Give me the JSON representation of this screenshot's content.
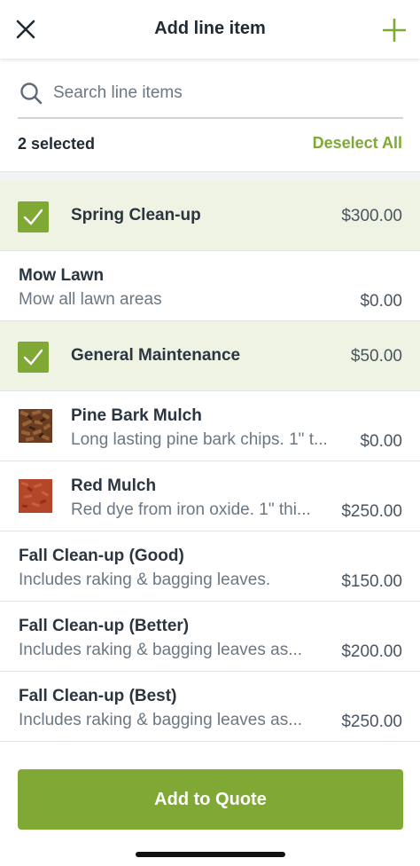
{
  "header": {
    "title": "Add line item",
    "close_icon": "close-icon",
    "add_icon": "plus-icon"
  },
  "search": {
    "placeholder": "Search line items",
    "value": ""
  },
  "selection": {
    "count_label": "2 selected",
    "deselect_label": "Deselect All"
  },
  "colors": {
    "accent": "#7fa934",
    "selected_row": "#eef3e4",
    "text": "#2a3540",
    "muted": "#6b7782"
  },
  "items": [
    {
      "name": "Spring Clean-up",
      "description": "",
      "price": "$300.00",
      "selected": true,
      "thumbnail": ""
    },
    {
      "name": "Mow Lawn",
      "description": "Mow all lawn areas",
      "price": "$0.00",
      "selected": false,
      "thumbnail": ""
    },
    {
      "name": "General Maintenance",
      "description": "",
      "price": "$50.00",
      "selected": true,
      "thumbnail": ""
    },
    {
      "name": "Pine Bark Mulch",
      "description": "Long lasting pine bark chips. 1\" t...",
      "price": "$0.00",
      "selected": false,
      "thumbnail": "pine-bark-mulch-image"
    },
    {
      "name": "Red Mulch",
      "description": "Red dye from iron oxide. 1\" thi...",
      "price": "$250.00",
      "selected": false,
      "thumbnail": "red-mulch-image"
    },
    {
      "name": "Fall Clean-up (Good)",
      "description": "Includes raking & bagging leaves.",
      "price": "$150.00",
      "selected": false,
      "thumbnail": ""
    },
    {
      "name": "Fall Clean-up (Better)",
      "description": "Includes raking & bagging leaves as...",
      "price": "$200.00",
      "selected": false,
      "thumbnail": ""
    },
    {
      "name": "Fall Clean-up (Best)",
      "description": "Includes raking & bagging leaves as...",
      "price": "$250.00",
      "selected": false,
      "thumbnail": ""
    }
  ],
  "footer": {
    "button_label": "Add to Quote"
  }
}
